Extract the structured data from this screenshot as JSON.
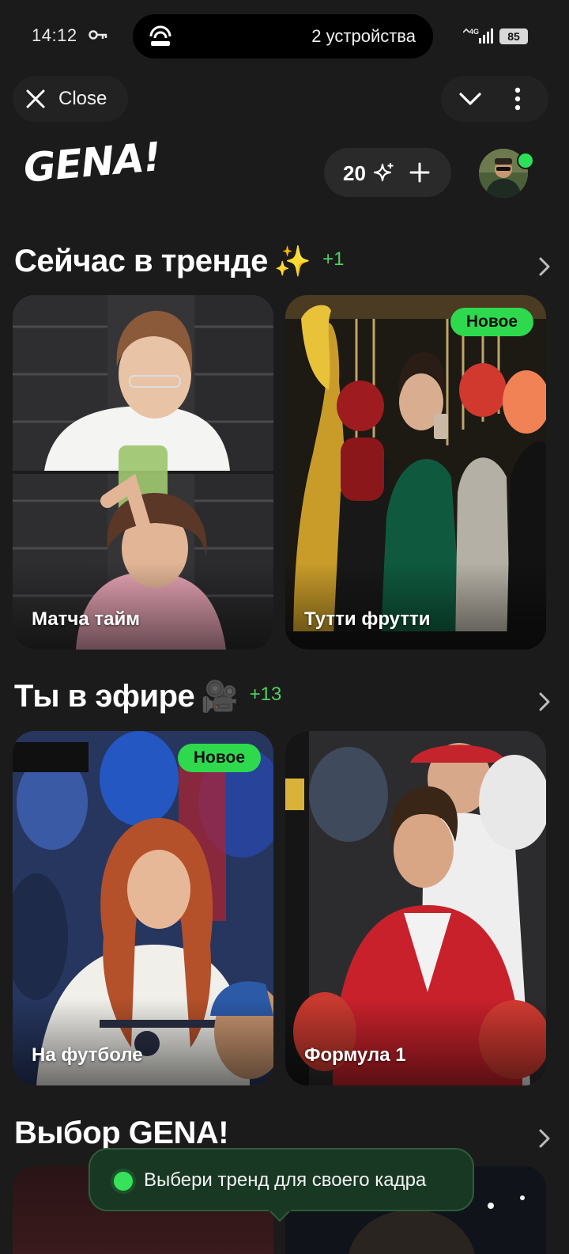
{
  "statusbar": {
    "time": "14:12",
    "devices": "2 устройства",
    "network": "4G",
    "battery": "85"
  },
  "topbar": {
    "close_label": "Close"
  },
  "header": {
    "logo": "GENA!",
    "credits_count": "20"
  },
  "sections": [
    {
      "title": "Сейчас в тренде",
      "emoji": "✨",
      "extra": "+1",
      "cards": [
        {
          "caption": "Матча тайм",
          "badge": ""
        },
        {
          "caption": "Тутти фрутти",
          "badge": "Новое"
        }
      ]
    },
    {
      "title": "Ты в эфире",
      "emoji": "🎥",
      "extra": "+13",
      "cards": [
        {
          "caption": "На футболе",
          "badge": "Новое"
        },
        {
          "caption": "Формула 1",
          "badge": ""
        }
      ]
    },
    {
      "title": "Выбор GENA!",
      "emoji": "",
      "extra": ""
    }
  ],
  "toast": {
    "text": "Выбери тренд для своего кадра"
  },
  "colors": {
    "background": "#1b1b1b",
    "accent_green": "#2fd94e",
    "count_green": "#4fcf5e"
  }
}
